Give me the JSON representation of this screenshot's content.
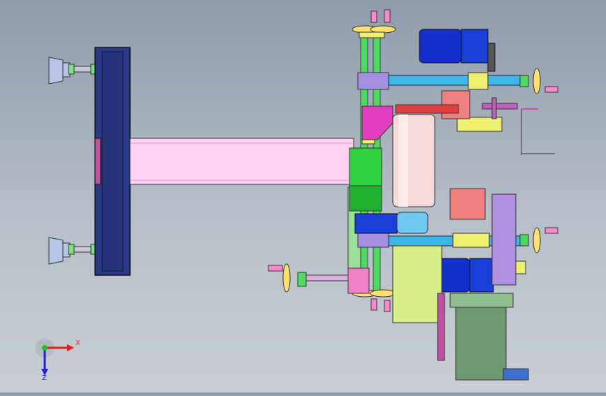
{
  "viewport": {
    "background_top": "#8e9bab",
    "background_bottom": "#c9ced4"
  },
  "triad": {
    "x_label": "X",
    "z_label": "Z",
    "x_color": "#e02020",
    "y_color": "#20c020",
    "z_color": "#2020e0"
  },
  "colors": {
    "frame_navy": "#2a3a8a",
    "beam_pink": "#ffd0f4",
    "shaft_cyan": "#3fb6e8",
    "motor_blue": "#1330cc",
    "magenta": "#e040c0",
    "yellow": "#f0f070",
    "green": "#2fcf3f",
    "lavender": "#b090e0",
    "salmon": "#f08080",
    "olive_plate": "#d8ee88",
    "dark_green": "#6f9a6f"
  }
}
